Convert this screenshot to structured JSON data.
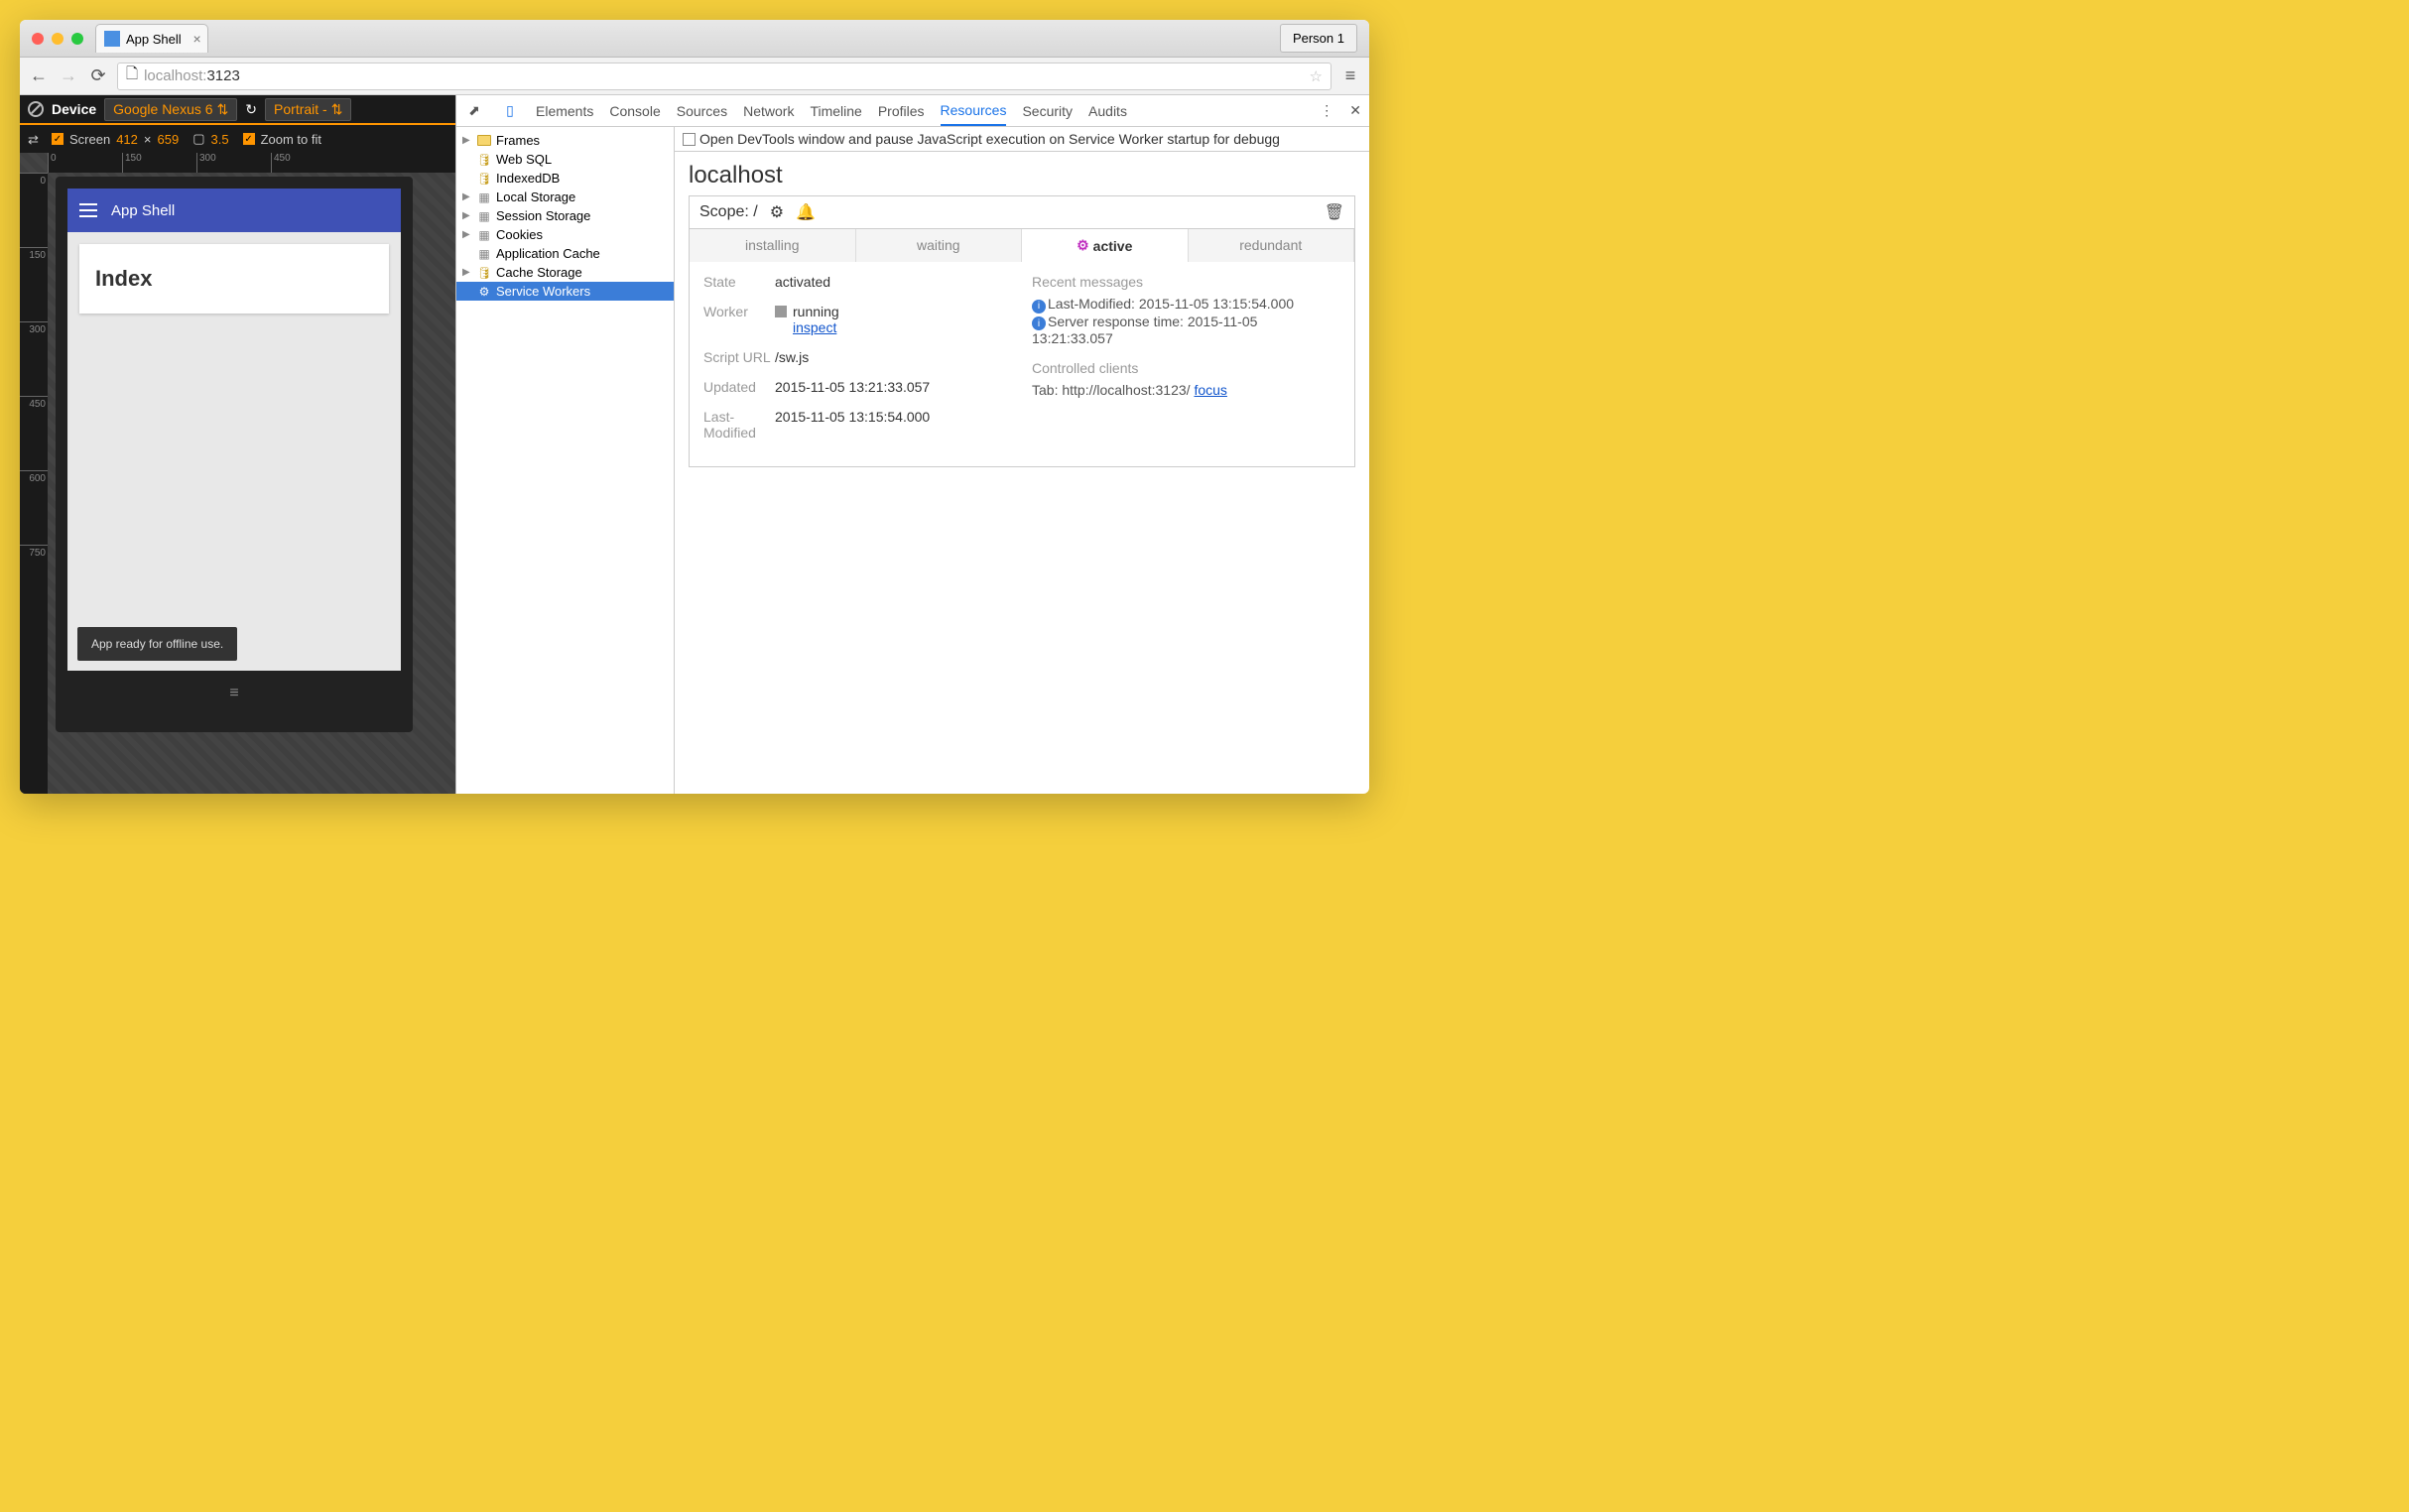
{
  "browser": {
    "tab_title": "App Shell",
    "profile": "Person 1",
    "url_host": "localhost:",
    "url_port": "3123"
  },
  "device_toolbar": {
    "label": "Device",
    "device_name": "Google Nexus 6",
    "orientation": "Portrait - ",
    "screen_label": "Screen",
    "screen_w": "412",
    "screen_x": "×",
    "screen_h": "659",
    "dpr": "3.5",
    "zoom_label": "Zoom to fit"
  },
  "ruler_h": [
    "0",
    "150",
    "300",
    "450"
  ],
  "ruler_v": [
    "0",
    "150",
    "300",
    "450",
    "600",
    "750"
  ],
  "app": {
    "title": "App Shell",
    "card": "Index",
    "toast": "App ready for offline use."
  },
  "devtools": {
    "tabs": [
      "Elements",
      "Console",
      "Sources",
      "Network",
      "Timeline",
      "Profiles",
      "Resources",
      "Security",
      "Audits"
    ],
    "active_tab": "Resources",
    "infobar": "Open DevTools window and pause JavaScript execution on Service Worker startup for debugg",
    "tree": [
      {
        "label": "Frames",
        "icon": "folder",
        "arrow": true
      },
      {
        "label": "Web SQL",
        "icon": "db"
      },
      {
        "label": "IndexedDB",
        "icon": "db"
      },
      {
        "label": "Local Storage",
        "icon": "grid",
        "arrow": true
      },
      {
        "label": "Session Storage",
        "icon": "grid",
        "arrow": true
      },
      {
        "label": "Cookies",
        "icon": "grid",
        "arrow": true
      },
      {
        "label": "Application Cache",
        "icon": "grid"
      },
      {
        "label": "Cache Storage",
        "icon": "db",
        "arrow": true
      },
      {
        "label": "Service Workers",
        "icon": "gear",
        "selected": true
      }
    ],
    "detail": {
      "host": "localhost",
      "scope_label": "Scope: /",
      "sw_tabs": [
        "installing",
        "waiting",
        "active",
        "redundant"
      ],
      "sw_active": "active",
      "left": {
        "state_k": "State",
        "state_v": "activated",
        "worker_k": "Worker",
        "worker_status": "running",
        "worker_inspect": "inspect",
        "script_k": "Script URL",
        "script_v": "/sw.js",
        "updated_k": "Updated",
        "updated_v": "2015-11-05 13:21:33.057",
        "lm_k": "Last-Modified",
        "lm_v": "2015-11-05 13:15:54.000"
      },
      "right": {
        "recent_hdr": "Recent messages",
        "msg1": "Last-Modified: 2015-11-05 13:15:54.000",
        "msg2": "Server response time: 2015-11-05 13:21:33.057",
        "clients_hdr": "Controlled clients",
        "client_prefix": "Tab: http://localhost:3123/ ",
        "client_focus": "focus"
      }
    }
  }
}
